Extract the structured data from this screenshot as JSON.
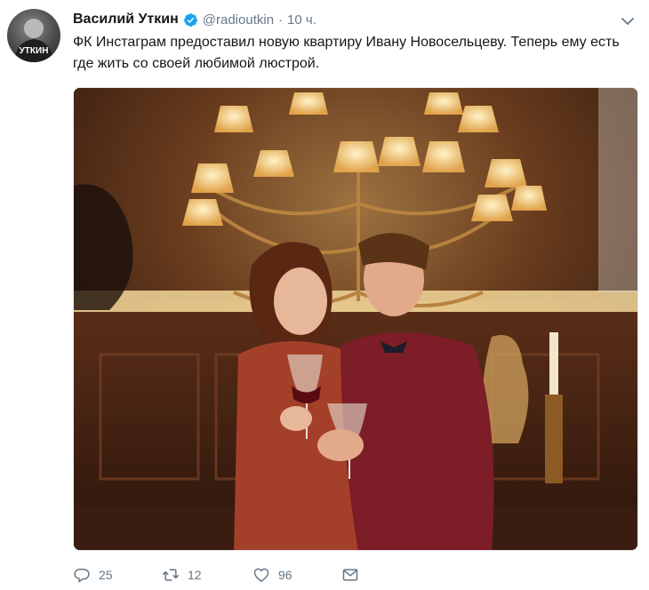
{
  "tweet": {
    "author_name": "Василий Уткин",
    "handle": "@radioutkin",
    "separator": "·",
    "time": "10 ч.",
    "avatar_text": "УТКИН",
    "text": "ФК Инстаграм предоставил новую квартиру Ивану Новосельцеву. Теперь ему есть где жить со своей любимой люстрой."
  },
  "actions": {
    "replies": "25",
    "retweets": "12",
    "likes": "96"
  },
  "icons": [
    "verified-badge-icon",
    "chevron-down-icon",
    "reply-icon",
    "retweet-icon",
    "like-icon",
    "direct-message-icon"
  ],
  "colors": {
    "verified": "#1da1f2",
    "muted": "#657786",
    "text": "#14171a"
  }
}
